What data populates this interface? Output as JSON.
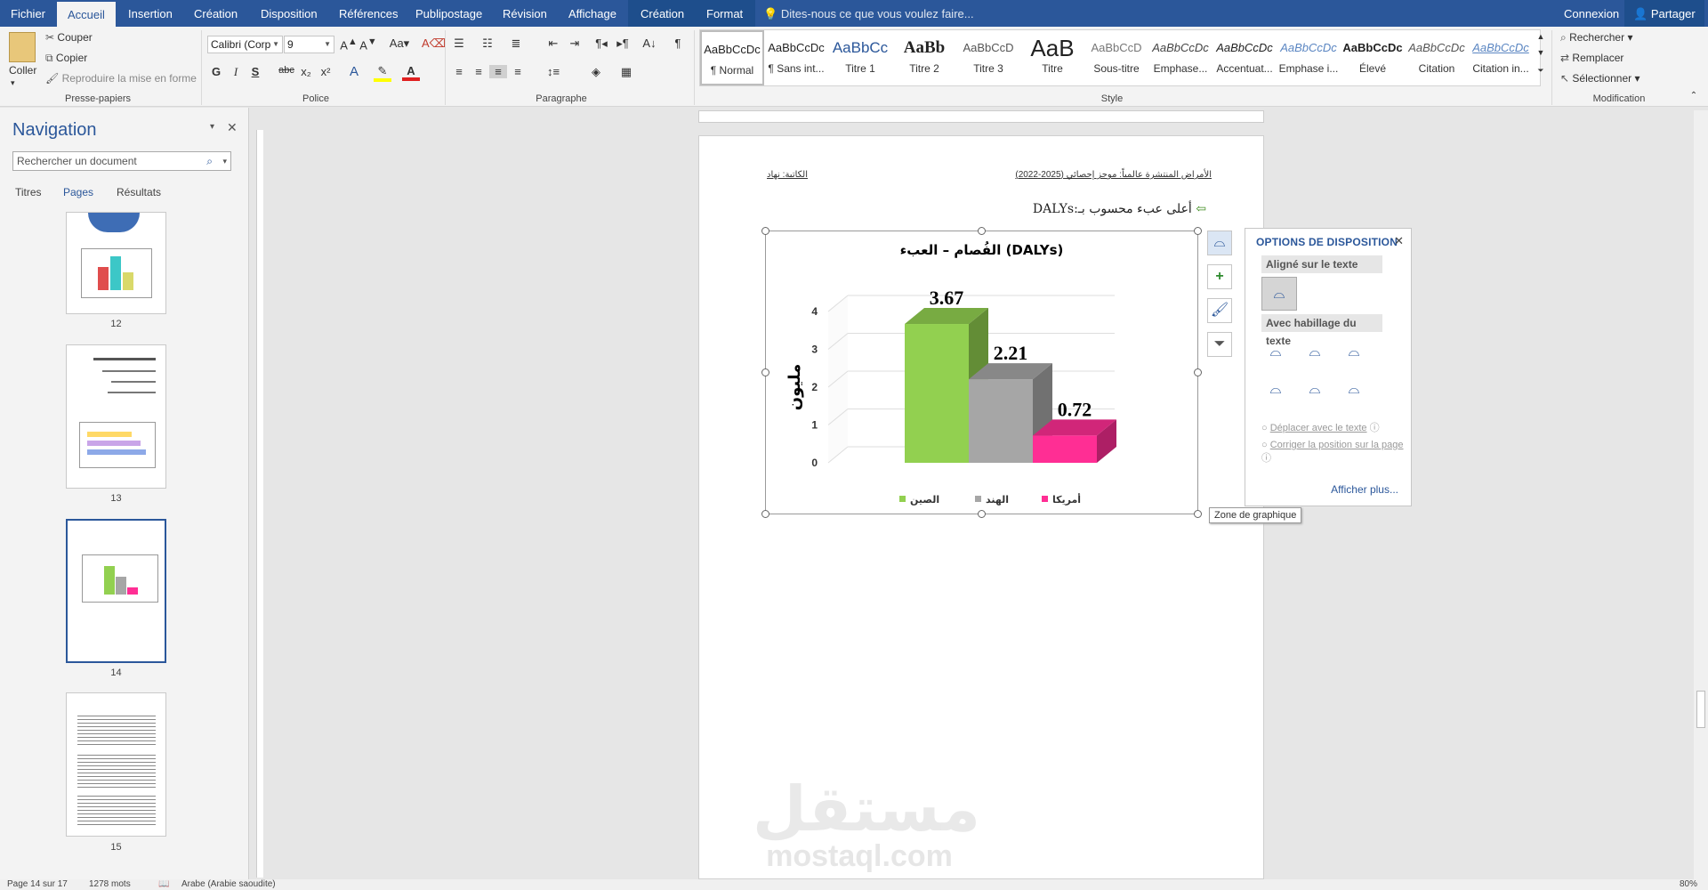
{
  "tabs": {
    "file": "Fichier",
    "home": "Accueil",
    "insert": "Insertion",
    "design": "Création",
    "layout": "Disposition",
    "references": "Références",
    "mailings": "Publipostage",
    "review": "Révision",
    "view": "Affichage",
    "chart_design": "Création",
    "format": "Format"
  },
  "tell_me": "Dites-nous ce que vous voulez faire...",
  "account": {
    "signin": "Connexion",
    "share": "Partager"
  },
  "clipboard": {
    "paste": "Coller",
    "cut": "Couper",
    "copy": "Copier",
    "format_painter": "Reproduire la mise en forme",
    "group": "Presse-papiers"
  },
  "font": {
    "name": "Calibri (Corp",
    "size": "9",
    "bold": "G",
    "italic": "I",
    "underline": "S",
    "strike": "abc",
    "sub": "x₂",
    "sup": "x²",
    "group": "Police"
  },
  "paragraph": {
    "group": "Paragraphe"
  },
  "styles": {
    "group": "Style",
    "items": [
      {
        "preview": "AaBbCcDc",
        "name": "¶ Normal"
      },
      {
        "preview": "AaBbCcDc",
        "name": "¶ Sans int..."
      },
      {
        "preview": "AaBbCc",
        "name": "Titre 1"
      },
      {
        "preview": "AaBb",
        "name": "Titre 2"
      },
      {
        "preview": "AaBbCcD",
        "name": "Titre 3"
      },
      {
        "preview": "AaB",
        "name": "Titre"
      },
      {
        "preview": "AaBbCcD",
        "name": "Sous-titre"
      },
      {
        "preview": "AaBbCcDc",
        "name": "Emphase..."
      },
      {
        "preview": "AaBbCcDc",
        "name": "Accentuat..."
      },
      {
        "preview": "AaBbCcDc",
        "name": "Emphase i..."
      },
      {
        "preview": "AaBbCcDc",
        "name": "Élevé"
      },
      {
        "preview": "AaBbCcDc",
        "name": "Citation"
      },
      {
        "preview": "AaBbCcDc",
        "name": "Citation in..."
      }
    ]
  },
  "editing": {
    "find": "Rechercher",
    "replace": "Remplacer",
    "select": "Sélectionner",
    "group": "Modification"
  },
  "nav": {
    "title": "Navigation",
    "search_placeholder": "Rechercher un document",
    "tab_headings": "Titres",
    "tab_pages": "Pages",
    "tab_results": "Résultats",
    "pages": [
      "12",
      "13",
      "14",
      "15"
    ]
  },
  "doc": {
    "header_left": "الكاتبة: نهاد",
    "header_right": "الأمراض المنتشرة عالمياً: موجز إحصائي (2025-2022)",
    "line1": "أعلى عبء محسوب بـ:DALYs",
    "watermark_ar": "مستقل",
    "watermark_en": "mostaql.com"
  },
  "chart_data": {
    "type": "bar",
    "title": "الفُصام – العبء (DALYs)",
    "ylabel": "مليون",
    "categories": [
      "الصين",
      "الهند",
      "أمريكا"
    ],
    "values": [
      3.67,
      2.21,
      0.72
    ],
    "colors": [
      "#92d050",
      "#a6a6a6",
      "#ff2e94"
    ],
    "ylim": [
      0,
      4
    ],
    "yticks": [
      "0",
      "1",
      "2",
      "3",
      "4"
    ],
    "legend": "bottom"
  },
  "layout_options": {
    "title": "OPTIONS DE DISPOSITION",
    "inline": "Aligné sur le texte",
    "wrap": "Avec habillage du texte",
    "move": "Déplacer avec le texte",
    "fix": "Corriger la position sur la page",
    "more": "Afficher plus..."
  },
  "tooltip": "Zone de graphique",
  "status": {
    "page": "Page 14 sur 17",
    "words": "1278 mots",
    "lang": "Arabe (Arabie saoudite)",
    "zoom": "80%"
  }
}
